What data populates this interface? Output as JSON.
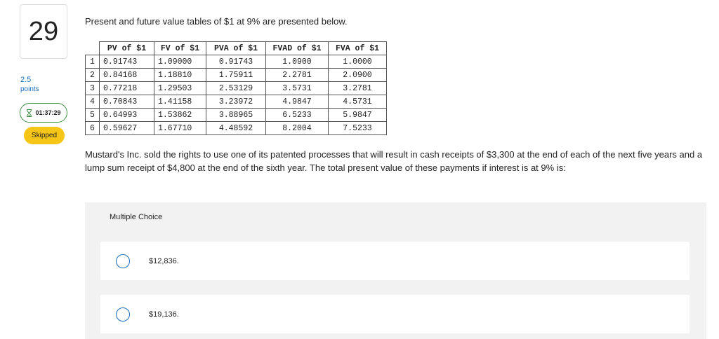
{
  "question": {
    "number": "29",
    "points_value": "2.5",
    "points_label": "points",
    "timer": "01:37:29",
    "status": "Skipped",
    "prompt": "Present and future value tables of $1 at 9% are presented below.",
    "problem_text": "Mustard's Inc. sold the rights to use one of its patented processes that will result in cash receipts of $3,300 at the end of each of the next five years and a lump sum receipt of $4,800 at the end of the sixth year. The total present value of these payments if interest is at 9% is:"
  },
  "table": {
    "headers": [
      "PV of $1",
      "FV of $1",
      "PVA of $1",
      "FVAD of $1",
      "FVA of $1"
    ],
    "rows": [
      [
        "1",
        "0.91743",
        "1.09000",
        "0.91743",
        "1.0900",
        "1.0000"
      ],
      [
        "2",
        "0.84168",
        "1.18810",
        "1.75911",
        "2.2781",
        "2.0900"
      ],
      [
        "3",
        "0.77218",
        "1.29503",
        "2.53129",
        "3.5731",
        "3.2781"
      ],
      [
        "4",
        "0.70843",
        "1.41158",
        "3.23972",
        "4.9847",
        "4.5731"
      ],
      [
        "5",
        "0.64993",
        "1.53862",
        "3.88965",
        "6.5233",
        "5.9847"
      ],
      [
        "6",
        "0.59627",
        "1.67710",
        "4.48592",
        "8.2004",
        "7.5233"
      ]
    ]
  },
  "multiple_choice": {
    "title": "Multiple Choice",
    "options": [
      "$12,836.",
      "$19,136."
    ]
  },
  "colors": {
    "accent_blue": "#1a6ebc",
    "timer_border_green": "#3e8e41",
    "skipped_yellow": "#f5c518",
    "panel_gray": "#f2f2f2"
  },
  "icons": {
    "timer": "hourglass-icon"
  }
}
